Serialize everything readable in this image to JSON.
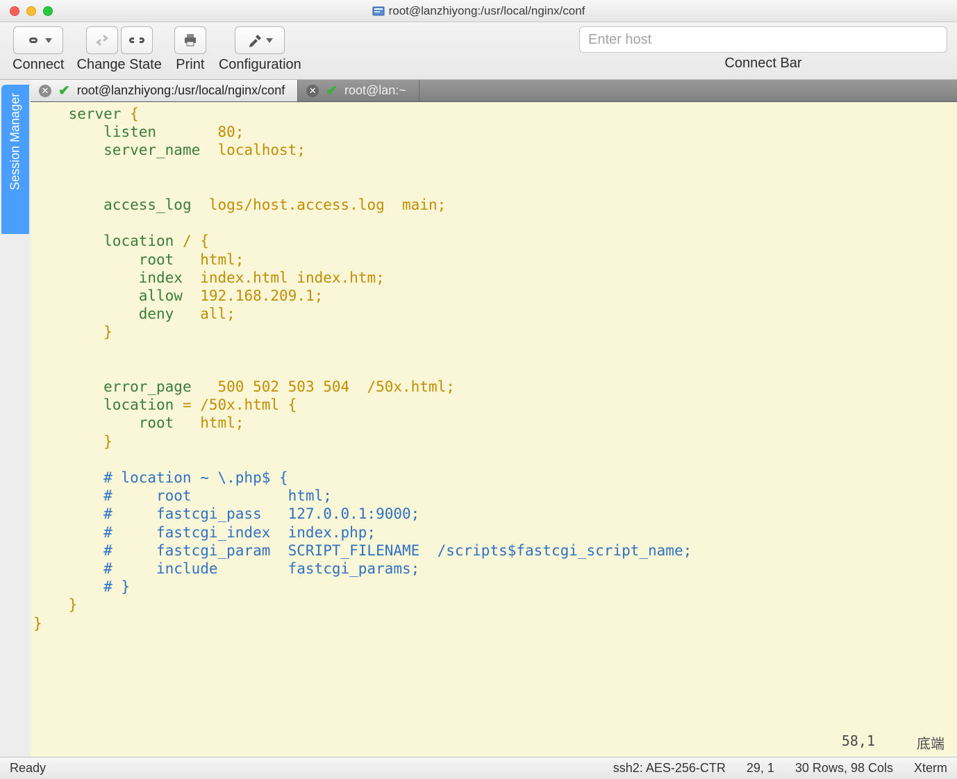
{
  "window": {
    "title": "root@lanzhiyong:/usr/local/nginx/conf"
  },
  "toolbar": {
    "connect_label": "Connect",
    "change_state_label": "Change State",
    "print_label": "Print",
    "configuration_label": "Configuration",
    "connect_bar_label": "Connect Bar",
    "host_placeholder": "Enter host"
  },
  "sidebar": {
    "session_manager_label": "Session Manager"
  },
  "tabs": [
    {
      "label": "root@lanzhiyong:/usr/local/nginx/conf",
      "active": true
    },
    {
      "label": "root@lan:~",
      "active": false
    }
  ],
  "terminal": {
    "lines": [
      "    server {",
      "        listen       80;",
      "        server_name  localhost;",
      "",
      "",
      "        access_log  logs/host.access.log  main;",
      "",
      "        location / {",
      "            root   html;",
      "            index  index.html index.htm;",
      "            allow  192.168.209.1;",
      "            deny   all;",
      "        }",
      "",
      "",
      "        error_page   500 502 503 504  /50x.html;",
      "        location = /50x.html {",
      "            root   html;",
      "        }",
      "",
      "        # location ~ \\.php$ {",
      "        #     root           html;",
      "        #     fastcgi_pass   127.0.0.1:9000;",
      "        #     fastcgi_index  index.php;",
      "        #     fastcgi_param  SCRIPT_FILENAME  /scripts$fastcgi_script_name;",
      "        #     include        fastcgi_params;",
      "        # }",
      "    }",
      "}"
    ],
    "vim_cursor": "58,1",
    "vim_scroll": "底端"
  },
  "statusbar": {
    "ready": "Ready",
    "protocol": "ssh2: AES-256-CTR",
    "pos": "29, 1",
    "size": "30 Rows, 98 Cols",
    "emulation": "Xterm"
  }
}
